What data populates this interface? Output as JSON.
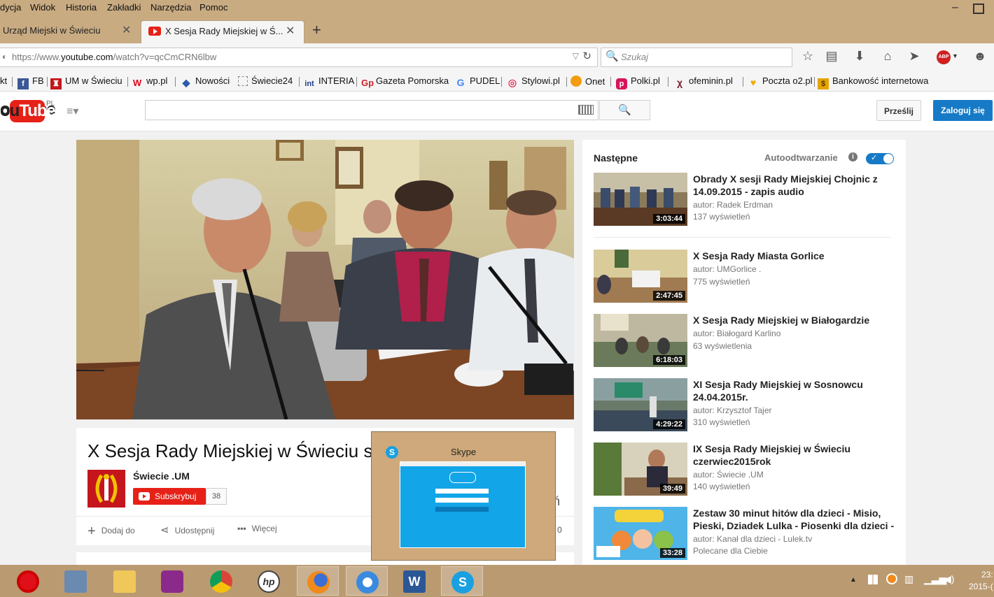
{
  "menu": [
    "dycja",
    "Widok",
    "Historia",
    "Zakładki",
    "Narzędzia",
    "Pomoc"
  ],
  "tabs": [
    {
      "label": "Urząd Miejski w Świeciu",
      "active": false
    },
    {
      "label": "X Sesja Rady Miejskiej w Ś...",
      "active": true
    }
  ],
  "new_tab_label": "+",
  "url": {
    "prefix": "https://www.",
    "domain": "youtube.com",
    "path": "/watch?v=qcCmCRN6lbw"
  },
  "search_placeholder": "Szukaj",
  "bookmarks": [
    {
      "label": "kt",
      "icon": "bookmark-icon",
      "color": ""
    },
    {
      "label": "FB",
      "icon": "facebook-icon",
      "color": "#3b5998"
    },
    {
      "label": "UM w Świeciu",
      "icon": "um-crest-icon",
      "color": "#c4161c"
    },
    {
      "label": "wp.pl",
      "icon": "wp-icon",
      "color": "#e3001b"
    },
    {
      "label": "Nowości",
      "icon": "news-icon",
      "color": "#2a5caa"
    },
    {
      "label": "Świecie24",
      "icon": "dotted-square-icon",
      "color": "#888888"
    },
    {
      "label": "INTERIA",
      "icon": "interia-icon",
      "color": "#1e3c8c"
    },
    {
      "label": "Gazeta Pomorska",
      "icon": "gp-icon",
      "color": "#d11f26"
    },
    {
      "label": "PUDEL",
      "icon": "google-icon",
      "color": "#4285f4"
    },
    {
      "label": "Stylowi.pl",
      "icon": "stylowi-icon",
      "color": "#e23a5e"
    },
    {
      "label": "Onet",
      "icon": "onet-icon",
      "color": "#f39c12"
    },
    {
      "label": "Polki.pl",
      "icon": "polki-icon",
      "color": "#d7145b"
    },
    {
      "label": "ofeminin.pl",
      "icon": "ofeminin-icon",
      "color": "#7a1d2b"
    },
    {
      "label": "Poczta o2.pl",
      "icon": "o2-icon",
      "color": "#f2a900"
    },
    {
      "label": "Bankowość internetowa",
      "icon": "bank-icon",
      "color": "#e5a400"
    }
  ],
  "youtube": {
    "logo_text": "ouTube",
    "region": "PL",
    "upload_label": "Prześlij",
    "signin_label": "Zaloguj się"
  },
  "video": {
    "title": "X Sesja Rady Miejskiej w Świeciu s",
    "channel": "Świecie .UM",
    "subscribe_label": "Subskrybuj",
    "subscriber_count": "38",
    "actions": {
      "add": "Dodaj do",
      "share": "Udostępnij",
      "more": "Więcej"
    },
    "partial_views": "ń",
    "partial_count": "0"
  },
  "sidebar": {
    "next_label": "Następne",
    "autoplay_label": "Autoodtwarzanie",
    "autoplay_on": true,
    "items": [
      {
        "title": "Obrady X sesji Rady Miejskiej Chojnic z 14.09.2015 - zapis audio",
        "author": "autor: Radek Erdman",
        "views": "137 wyświetleń",
        "duration": "3:03:44"
      },
      {
        "title": "X Sesja Rady Miasta Gorlice",
        "author": "autor: UMGorlice .",
        "views": "775 wyświetleń",
        "duration": "2:47:45"
      },
      {
        "title": "X Sesja Rady Miejskiej w Białogardzie",
        "author": "autor: Białogard Karlino",
        "views": "63 wyświetlenia",
        "duration": "6:18:03"
      },
      {
        "title": "XI Sesja Rady Miejskiej w Sosnowcu 24.04.2015r.",
        "author": "autor: Krzysztof Tajer",
        "views": "310 wyświetleń",
        "duration": "4:29:22"
      },
      {
        "title": "IX Sesja Rady Miejskiej w Świeciu czerwiec2015rok",
        "author": "autor: Świecie .UM",
        "views": "140 wyświetleń",
        "duration": "39:49"
      },
      {
        "title": "Zestaw 30 minut hitów dla dzieci - Misio, Pieski, Dziadek Lulka - Piosenki dla dzieci -",
        "author": "autor: Kanał dla dzieci - Lulek.tv",
        "views": "Polecane dla Ciebie",
        "duration": "33:28"
      }
    ]
  },
  "skype_popup": {
    "title": "Skype"
  },
  "taskbar": {
    "apps": [
      "opera-icon",
      "calculator-icon",
      "file-explorer-icon",
      "wifi-display-icon",
      "chrome-icon",
      "hp-icon",
      "firefox-icon",
      "brightness-icon",
      "word-icon",
      "skype-icon"
    ],
    "clock_time": "23:",
    "clock_date": "2015-("
  },
  "colors": {
    "chrome_bg": "#c9ab82",
    "youtube_red": "#e62117",
    "signin_blue": "#167ac6",
    "taskbar": "#ba9a71"
  }
}
